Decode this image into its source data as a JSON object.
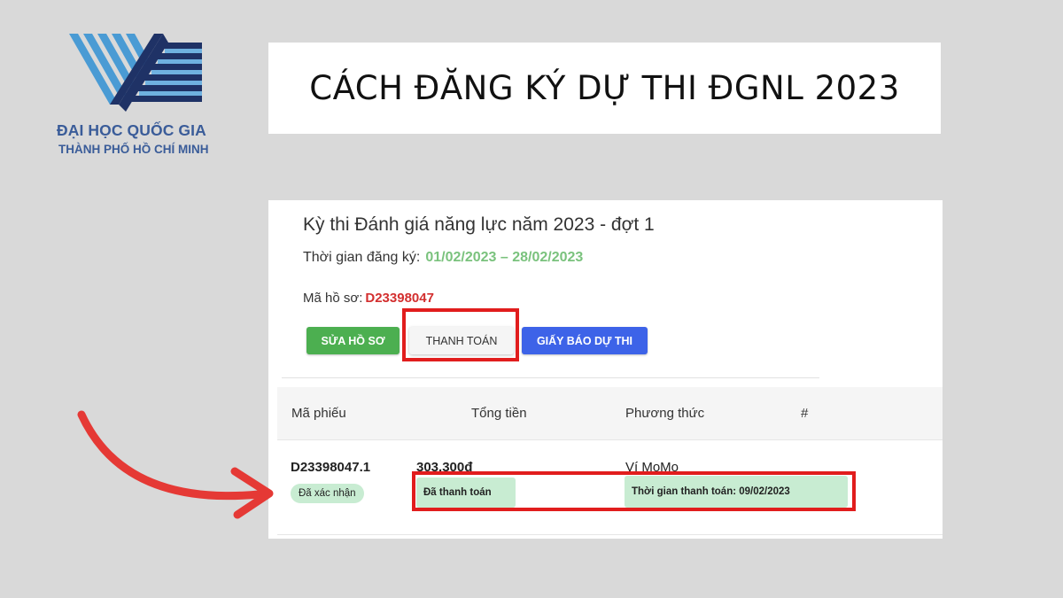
{
  "logo": {
    "line1": "ĐẠI HỌC QUỐC GIA",
    "line2": "THÀNH PHỐ HỒ CHÍ MINH"
  },
  "title": "CÁCH ĐĂNG KÝ DỰ THI ĐGNL 2023",
  "panel": {
    "exam_title": "Kỳ thi Đánh giá năng lực năm 2023 - đợt 1",
    "reg_label": "Thời gian đăng ký:",
    "reg_dates": "01/02/2023 – 28/02/2023",
    "code_label": "Mã hồ sơ:",
    "code_value": "D23398047",
    "buttons": {
      "edit": "SỬA HỒ SƠ",
      "pay": "THANH TOÁN",
      "notice": "GIẤY BÁO DỰ THI"
    },
    "table": {
      "headers": [
        "Mã phiếu",
        "Tổng tiền",
        "Phương thức",
        "#"
      ],
      "row": {
        "code": "D23398047.1",
        "status": "Đã xác nhận",
        "amount": "303.300đ",
        "payment_status": "Đã thanh toán",
        "method": "Ví MoMo",
        "payment_time": "Thời gian thanh toán: 09/02/2023"
      }
    }
  },
  "colors": {
    "background": "#d9d9d9",
    "logo_blue": "#3a5c99",
    "highlight_red": "#e11d1d",
    "green_button": "#4caf50",
    "blue_button": "#3d63e8",
    "date_green": "#7ac27d",
    "code_red": "#d32f2f",
    "badge_green": "#c8ecd2",
    "arrow_red": "#e53935"
  },
  "icons": {
    "logo": "vnu-hcm-logo-icon",
    "arrow": "curved-arrow-icon"
  }
}
